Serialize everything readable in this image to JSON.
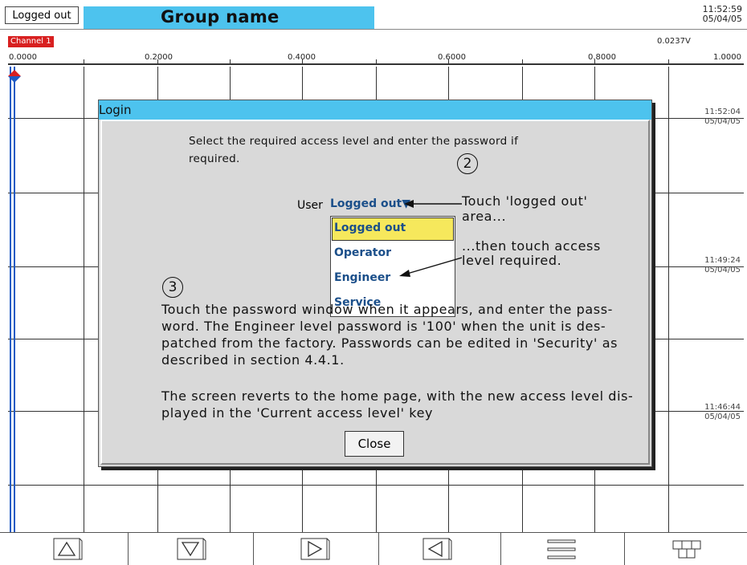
{
  "header": {
    "login_button": "Logged out",
    "group_name": "Group name",
    "time": "11:52:59",
    "date": "05/04/05"
  },
  "scale": {
    "channel_badge": "Channel 1",
    "reading": "0.0237V",
    "ticks": [
      "0.0000",
      "0.2000",
      "0.4000",
      "0.6000",
      "0.8000",
      "1.0000"
    ]
  },
  "timestamps": [
    {
      "time": "11:52:04",
      "date": "05/04/05"
    },
    {
      "time": "11:49:24",
      "date": "05/04/05"
    },
    {
      "time": "11:46:44",
      "date": "05/04/05"
    }
  ],
  "login_dialog": {
    "title": "Login",
    "instruction": "Select the required access level and enter the password if required.",
    "user_label": "User",
    "user_value": "Logged out▼",
    "options": [
      "Logged out",
      "Operator",
      "Engineer",
      "Service"
    ],
    "selected_option": "Logged out",
    "step2_number": "2",
    "step2_text_line1": "Touch 'logged out'",
    "step2_text_line2": "area...",
    "step2b_text_line1": "...then touch access",
    "step2b_text_line2": "level required.",
    "step3_number": "3",
    "step3_text_line1": "Touch the password window when it appears, and enter the pass-",
    "step3_text_line2": "word.  The Engineer level password is '100' when the unit is des-",
    "step3_text_line3": "patched from the factory. Passwords can be edited in 'Security' as",
    "step3_text_line4": "described in section 4.4.1.",
    "revert_line1": "The screen reverts to the home page, with the new access level dis-",
    "revert_line2": "played in the 'Current access level' key",
    "close_button": "Close"
  },
  "toolbar": {
    "icons": [
      "scroll-up-icon",
      "scroll-down-icon",
      "scroll-right-icon",
      "scroll-left-icon",
      "menu-icon",
      "layout-icon"
    ]
  },
  "colors": {
    "accent_blue": "#4dc3ee",
    "trace_blue": "#1e5bc4",
    "channel_red": "#d82020",
    "highlight_yellow": "#f6e85c"
  }
}
